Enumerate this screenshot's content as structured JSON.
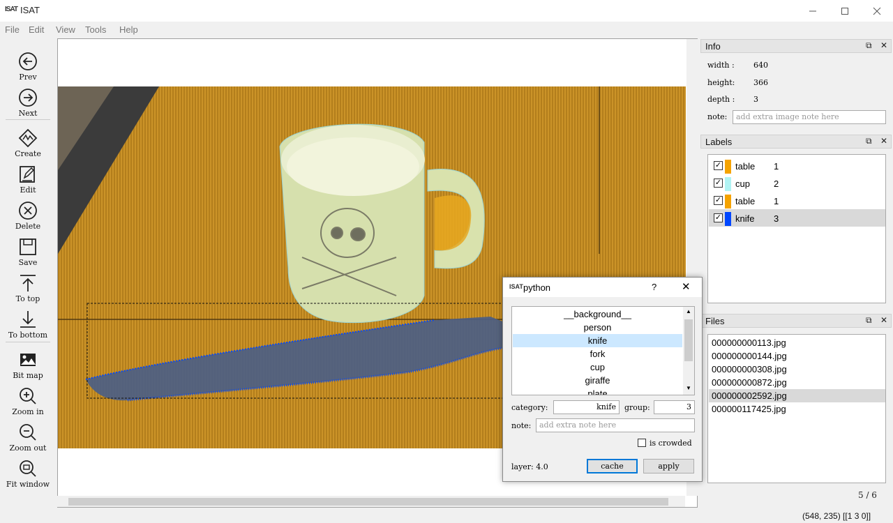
{
  "window": {
    "logo": "ISAT",
    "title": "ISAT",
    "minimize_icon": "minimize-icon",
    "maximize_icon": "maximize-icon",
    "close_icon": "close-icon"
  },
  "menu": [
    "File",
    "Edit",
    "View",
    "Tools",
    "Help"
  ],
  "toolbar": [
    {
      "label": "Prev",
      "icon": "arrow-left-circle-icon"
    },
    {
      "label": "Next",
      "icon": "arrow-right-circle-icon"
    },
    {
      "label": "Create",
      "icon": "polygon-create-icon"
    },
    {
      "label": "Edit",
      "icon": "edit-icon"
    },
    {
      "label": "Delete",
      "icon": "delete-circle-icon"
    },
    {
      "label": "Save",
      "icon": "save-icon"
    },
    {
      "label": "To top",
      "icon": "arrow-up-to-top-icon"
    },
    {
      "label": "To bottom",
      "icon": "arrow-down-to-bottom-icon"
    },
    {
      "label": "Bit map",
      "icon": "image-icon"
    },
    {
      "label": "Zoom in",
      "icon": "zoom-in-icon"
    },
    {
      "label": "Zoom out",
      "icon": "zoom-out-icon"
    },
    {
      "label": "Fit window",
      "icon": "fit-window-icon"
    }
  ],
  "info": {
    "title": "Info",
    "width_label": "width :",
    "width_value": "640",
    "height_label": "height:",
    "height_value": "366",
    "depth_label": "depth :",
    "depth_value": "3",
    "note_label": "note:",
    "note_placeholder": "add extra image note here"
  },
  "labels": {
    "title": "Labels",
    "items": [
      {
        "name": "table",
        "group": "1",
        "color": "#f5a300",
        "checked": true,
        "selected": false
      },
      {
        "name": "cup",
        "group": "2",
        "color": "#b0f3f3",
        "checked": true,
        "selected": false
      },
      {
        "name": "table",
        "group": "1",
        "color": "#f5a300",
        "checked": true,
        "selected": false
      },
      {
        "name": "knife",
        "group": "3",
        "color": "#0047ff",
        "checked": true,
        "selected": true
      }
    ]
  },
  "files": {
    "title": "Files",
    "items": [
      {
        "name": "000000000113.jpg",
        "selected": false
      },
      {
        "name": "000000000144.jpg",
        "selected": false
      },
      {
        "name": "000000000308.jpg",
        "selected": false
      },
      {
        "name": "000000000872.jpg",
        "selected": false
      },
      {
        "name": "000000002592.jpg",
        "selected": true
      },
      {
        "name": "000000117425.jpg",
        "selected": false
      }
    ],
    "count": "5 / 6"
  },
  "status": "(548, 235) [[1 3 0]]",
  "dialog": {
    "logo": "ISAT",
    "title": "python",
    "help": "?",
    "categories": [
      "__background__",
      "person",
      "knife",
      "fork",
      "cup",
      "giraffe",
      "plate"
    ],
    "selected_category": "knife",
    "category_label": "category:",
    "category_value": "knife",
    "group_label": "group:",
    "group_value": "3",
    "note_label": "note:",
    "note_placeholder": "add extra note here",
    "crowded_label": "is crowded",
    "layer_text": "layer: 4.0",
    "cache_label": "cache",
    "apply_label": "apply"
  },
  "colors": {
    "accent": "#0078d7",
    "table_mask": "#f5a300",
    "cup_mask": "#b0f3f3",
    "knife_mask": "#0047ff"
  }
}
